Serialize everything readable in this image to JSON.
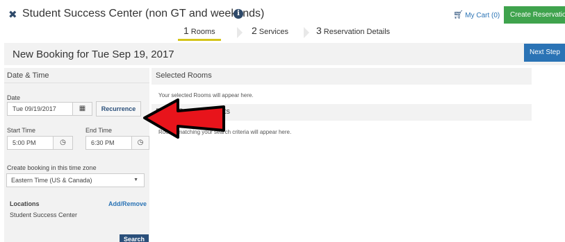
{
  "header": {
    "title": "Student Success Center (non GT and weekends)",
    "cart_label": "My Cart (0)",
    "create_button": "Create Reservation"
  },
  "steps": [
    {
      "number": "1",
      "label": "Rooms",
      "active": true
    },
    {
      "number": "2",
      "label": "Services",
      "active": false
    },
    {
      "number": "3",
      "label": "Reservation Details",
      "active": false
    }
  ],
  "booking": {
    "title": "New Booking for Tue Sep 19, 2017",
    "next_button": "Next Step"
  },
  "date_time": {
    "heading": "Date & Time",
    "date_label": "Date",
    "date_value": "Tue 09/19/2017",
    "recurrence_button": "Recurrence",
    "start_label": "Start Time",
    "start_value": "5:00 PM",
    "end_label": "End Time",
    "end_value": "6:30 PM",
    "timezone_label": "Create booking in this time zone",
    "timezone_value": "Eastern Time (US & Canada)",
    "locations_label": "Locations",
    "add_remove_link": "Add/Remove",
    "location_value": "Student Success Center",
    "search_button": "Search"
  },
  "selected_rooms": {
    "heading": "Selected Rooms",
    "empty_text": "Your selected Rooms will appear here."
  },
  "search_results": {
    "heading": "Room Search Results",
    "empty_text": "Rooms matching your search criteria will appear here."
  },
  "colors": {
    "accent_green": "#3fa34d",
    "accent_blue": "#2a73b5",
    "step_underline": "#d4c41a",
    "annotation_arrow": "#e8141b"
  },
  "icons": [
    "close-icon",
    "info-icon",
    "cart-icon",
    "calendar-icon",
    "clock-icon",
    "dropdown-caret-icon"
  ]
}
